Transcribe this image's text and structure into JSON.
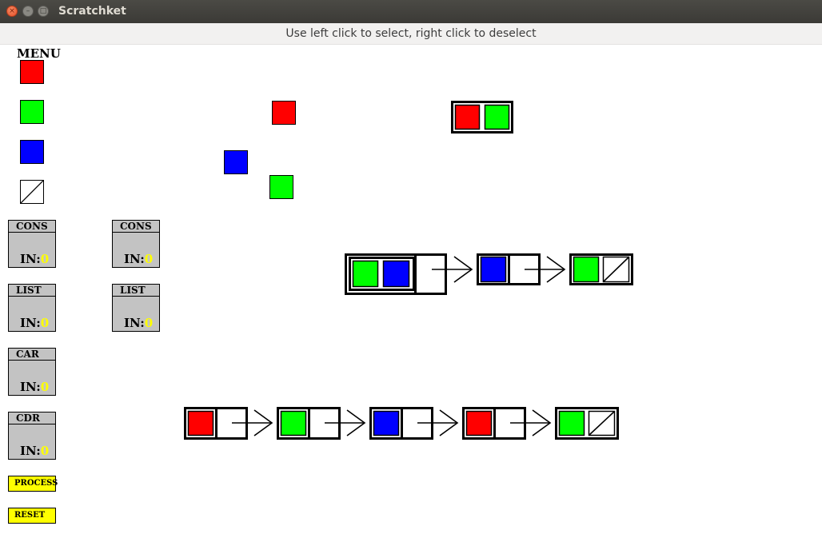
{
  "window": {
    "title": "Scratchket",
    "close_glyph": "×",
    "min_glyph": "–",
    "max_glyph": "□"
  },
  "hint": "Use left click to select, right click to deselect",
  "menu": {
    "title": "MENU",
    "colors": {
      "red": "#ff0000",
      "green": "#00ff00",
      "blue": "#0000ff",
      "yellow": "#ffff00",
      "gray": "#c3c3c3"
    },
    "ops": [
      {
        "label": "CONS",
        "in_label": "IN:",
        "in_count": "0"
      },
      {
        "label": "LIST",
        "in_label": "IN:",
        "in_count": "0"
      },
      {
        "label": "CAR",
        "in_label": "IN:",
        "in_count": "0"
      },
      {
        "label": "CDR",
        "in_label": "IN:",
        "in_count": "0"
      }
    ],
    "ops_placed": [
      {
        "label": "CONS",
        "in_label": "IN:",
        "in_count": "0"
      },
      {
        "label": "LIST",
        "in_label": "IN:",
        "in_count": "0"
      }
    ],
    "process_label": "PROCESS",
    "reset_label": "RESET"
  },
  "canvas": {
    "loose_atoms": [
      "red",
      "blue",
      "green"
    ],
    "pair": [
      "red",
      "green"
    ],
    "middle_list": "((green blue) blue green)",
    "bottom_list": [
      "red",
      "green",
      "blue",
      "red",
      "green"
    ]
  }
}
